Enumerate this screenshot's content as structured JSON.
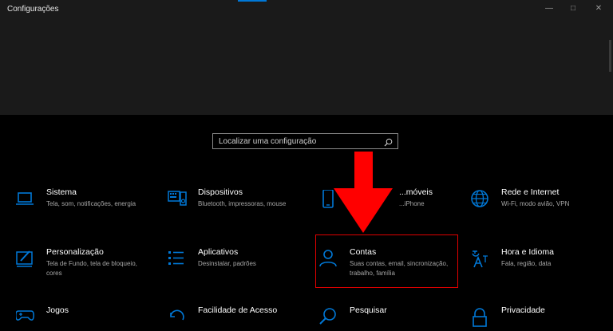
{
  "window": {
    "title": "Configurações",
    "controls": {
      "minimize": "—",
      "maximize": "□",
      "close": "✕"
    }
  },
  "search": {
    "placeholder": "Localizar uma configuração"
  },
  "tiles": [
    {
      "id": "sistema",
      "name": "Sistema",
      "desc": "Tela, som, notificações, energia",
      "icon": "laptop-icon"
    },
    {
      "id": "dispositivos",
      "name": "Dispositivos",
      "desc": "Bluetooth, impressoras, mouse",
      "icon": "keyboard-icon"
    },
    {
      "id": "telefone",
      "name": "...móveis",
      "desc": "...iPhone",
      "icon": "phone-icon"
    },
    {
      "id": "rede",
      "name": "Rede e Internet",
      "desc": "Wi-Fi, modo avião, VPN",
      "icon": "globe-icon"
    },
    {
      "id": "personalizacao",
      "name": "Personalização",
      "desc": "Tela de Fundo, tela de bloqueio, cores",
      "icon": "paint-icon"
    },
    {
      "id": "aplicativos",
      "name": "Aplicativos",
      "desc": "Desinstalar, padrões",
      "icon": "apps-list-icon"
    },
    {
      "id": "contas",
      "name": "Contas",
      "desc": "Suas contas, email, sincronização, trabalho, família",
      "icon": "person-icon"
    },
    {
      "id": "hora",
      "name": "Hora e Idioma",
      "desc": "Fala, região, data",
      "icon": "language-icon"
    },
    {
      "id": "jogos",
      "name": "Jogos",
      "desc": "",
      "icon": "gamepad-icon"
    },
    {
      "id": "acesso",
      "name": "Facilidade de Acesso",
      "desc": "",
      "icon": "accessibility-icon"
    },
    {
      "id": "pesquisar",
      "name": "Pesquisar",
      "desc": "",
      "icon": "search-icon"
    },
    {
      "id": "privacidade",
      "name": "Privacidade",
      "desc": "",
      "icon": "lock-icon"
    }
  ],
  "colors": {
    "accent": "#0078d7",
    "annotation": "#ff0000"
  }
}
